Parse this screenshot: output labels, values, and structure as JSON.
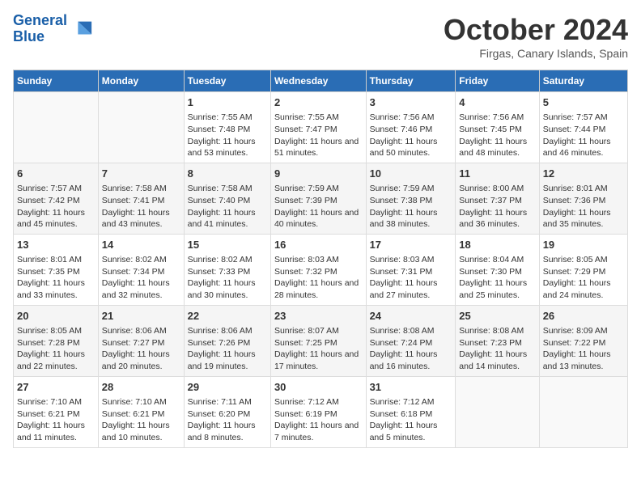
{
  "header": {
    "logo_line1": "General",
    "logo_line2": "Blue",
    "month": "October 2024",
    "location": "Firgas, Canary Islands, Spain"
  },
  "days_of_week": [
    "Sunday",
    "Monday",
    "Tuesday",
    "Wednesday",
    "Thursday",
    "Friday",
    "Saturday"
  ],
  "weeks": [
    [
      {
        "day": "",
        "detail": ""
      },
      {
        "day": "",
        "detail": ""
      },
      {
        "day": "1",
        "detail": "Sunrise: 7:55 AM\nSunset: 7:48 PM\nDaylight: 11 hours and 53 minutes."
      },
      {
        "day": "2",
        "detail": "Sunrise: 7:55 AM\nSunset: 7:47 PM\nDaylight: 11 hours and 51 minutes."
      },
      {
        "day": "3",
        "detail": "Sunrise: 7:56 AM\nSunset: 7:46 PM\nDaylight: 11 hours and 50 minutes."
      },
      {
        "day": "4",
        "detail": "Sunrise: 7:56 AM\nSunset: 7:45 PM\nDaylight: 11 hours and 48 minutes."
      },
      {
        "day": "5",
        "detail": "Sunrise: 7:57 AM\nSunset: 7:44 PM\nDaylight: 11 hours and 46 minutes."
      }
    ],
    [
      {
        "day": "6",
        "detail": "Sunrise: 7:57 AM\nSunset: 7:42 PM\nDaylight: 11 hours and 45 minutes."
      },
      {
        "day": "7",
        "detail": "Sunrise: 7:58 AM\nSunset: 7:41 PM\nDaylight: 11 hours and 43 minutes."
      },
      {
        "day": "8",
        "detail": "Sunrise: 7:58 AM\nSunset: 7:40 PM\nDaylight: 11 hours and 41 minutes."
      },
      {
        "day": "9",
        "detail": "Sunrise: 7:59 AM\nSunset: 7:39 PM\nDaylight: 11 hours and 40 minutes."
      },
      {
        "day": "10",
        "detail": "Sunrise: 7:59 AM\nSunset: 7:38 PM\nDaylight: 11 hours and 38 minutes."
      },
      {
        "day": "11",
        "detail": "Sunrise: 8:00 AM\nSunset: 7:37 PM\nDaylight: 11 hours and 36 minutes."
      },
      {
        "day": "12",
        "detail": "Sunrise: 8:01 AM\nSunset: 7:36 PM\nDaylight: 11 hours and 35 minutes."
      }
    ],
    [
      {
        "day": "13",
        "detail": "Sunrise: 8:01 AM\nSunset: 7:35 PM\nDaylight: 11 hours and 33 minutes."
      },
      {
        "day": "14",
        "detail": "Sunrise: 8:02 AM\nSunset: 7:34 PM\nDaylight: 11 hours and 32 minutes."
      },
      {
        "day": "15",
        "detail": "Sunrise: 8:02 AM\nSunset: 7:33 PM\nDaylight: 11 hours and 30 minutes."
      },
      {
        "day": "16",
        "detail": "Sunrise: 8:03 AM\nSunset: 7:32 PM\nDaylight: 11 hours and 28 minutes."
      },
      {
        "day": "17",
        "detail": "Sunrise: 8:03 AM\nSunset: 7:31 PM\nDaylight: 11 hours and 27 minutes."
      },
      {
        "day": "18",
        "detail": "Sunrise: 8:04 AM\nSunset: 7:30 PM\nDaylight: 11 hours and 25 minutes."
      },
      {
        "day": "19",
        "detail": "Sunrise: 8:05 AM\nSunset: 7:29 PM\nDaylight: 11 hours and 24 minutes."
      }
    ],
    [
      {
        "day": "20",
        "detail": "Sunrise: 8:05 AM\nSunset: 7:28 PM\nDaylight: 11 hours and 22 minutes."
      },
      {
        "day": "21",
        "detail": "Sunrise: 8:06 AM\nSunset: 7:27 PM\nDaylight: 11 hours and 20 minutes."
      },
      {
        "day": "22",
        "detail": "Sunrise: 8:06 AM\nSunset: 7:26 PM\nDaylight: 11 hours and 19 minutes."
      },
      {
        "day": "23",
        "detail": "Sunrise: 8:07 AM\nSunset: 7:25 PM\nDaylight: 11 hours and 17 minutes."
      },
      {
        "day": "24",
        "detail": "Sunrise: 8:08 AM\nSunset: 7:24 PM\nDaylight: 11 hours and 16 minutes."
      },
      {
        "day": "25",
        "detail": "Sunrise: 8:08 AM\nSunset: 7:23 PM\nDaylight: 11 hours and 14 minutes."
      },
      {
        "day": "26",
        "detail": "Sunrise: 8:09 AM\nSunset: 7:22 PM\nDaylight: 11 hours and 13 minutes."
      }
    ],
    [
      {
        "day": "27",
        "detail": "Sunrise: 7:10 AM\nSunset: 6:21 PM\nDaylight: 11 hours and 11 minutes."
      },
      {
        "day": "28",
        "detail": "Sunrise: 7:10 AM\nSunset: 6:21 PM\nDaylight: 11 hours and 10 minutes."
      },
      {
        "day": "29",
        "detail": "Sunrise: 7:11 AM\nSunset: 6:20 PM\nDaylight: 11 hours and 8 minutes."
      },
      {
        "day": "30",
        "detail": "Sunrise: 7:12 AM\nSunset: 6:19 PM\nDaylight: 11 hours and 7 minutes."
      },
      {
        "day": "31",
        "detail": "Sunrise: 7:12 AM\nSunset: 6:18 PM\nDaylight: 11 hours and 5 minutes."
      },
      {
        "day": "",
        "detail": ""
      },
      {
        "day": "",
        "detail": ""
      }
    ]
  ]
}
